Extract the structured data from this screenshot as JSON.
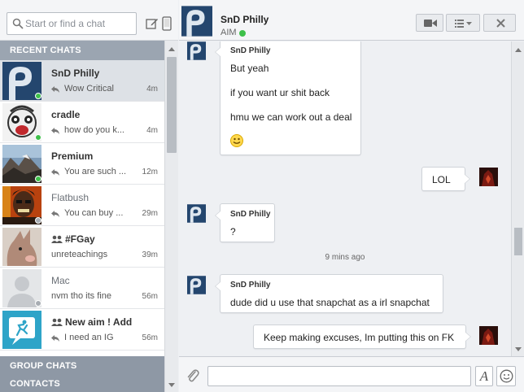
{
  "colors": {
    "accent": "#9ba5b1",
    "online": "#3ec04a",
    "offline": "#a8adb3",
    "selected_row": "#dde1e6",
    "message_bg": "#eef0f3"
  },
  "search": {
    "placeholder": "Start or find a chat"
  },
  "toolbar": {
    "compose_icon": "compose-icon",
    "mobile_icon": "mobile-icon"
  },
  "sidebar": {
    "recent_header": "RECENT CHATS",
    "group_header": "GROUP CHATS",
    "contacts_header": "CONTACTS",
    "chats": [
      {
        "name": "SnD Philly",
        "snippet": "Wow Critical",
        "time": "4m",
        "status": "online",
        "selected": true
      },
      {
        "name": "cradle",
        "snippet": "how do you k...",
        "time": "4m",
        "status": "online"
      },
      {
        "name": "Premium",
        "snippet": "You are such ...",
        "time": "12m",
        "status": "online"
      },
      {
        "name": "Flatbush",
        "snippet": "You can buy ...",
        "time": "29m",
        "status": "offline"
      },
      {
        "name": "#FGay",
        "snippet": "unreteachings",
        "time": "39m",
        "group": true
      },
      {
        "name": "Mac",
        "snippet": "nvm tho its fine",
        "time": "56m",
        "status": "offline"
      },
      {
        "name": "New aim ! Add",
        "snippet": "I need an IG",
        "time": "56m",
        "group": true
      }
    ]
  },
  "conversation": {
    "contact_name": "SnD Philly",
    "contact_status": "AIM",
    "header_buttons": [
      "video-call-button",
      "options-menu-button",
      "close-chat-button"
    ],
    "messages": [
      {
        "direction": "in",
        "sender": "SnD Philly",
        "lines": [
          "But yeah",
          "if you want ur shit back",
          "hmu we can work out a deal"
        ],
        "emoji": "smiley"
      },
      {
        "direction": "out",
        "lines": [
          "LOL"
        ]
      },
      {
        "direction": "in",
        "sender": "SnD Philly",
        "lines": [
          "?"
        ]
      },
      {
        "timestamp": "9 mins ago"
      },
      {
        "direction": "in",
        "sender": "SnD Philly",
        "lines": [
          "dude did u use that snapchat as a irl snapchat"
        ]
      },
      {
        "direction": "out",
        "lines": [
          "Keep making excuses, Im putting this on FK"
        ]
      }
    ]
  },
  "composer": {
    "value": "",
    "format_label": "A"
  }
}
